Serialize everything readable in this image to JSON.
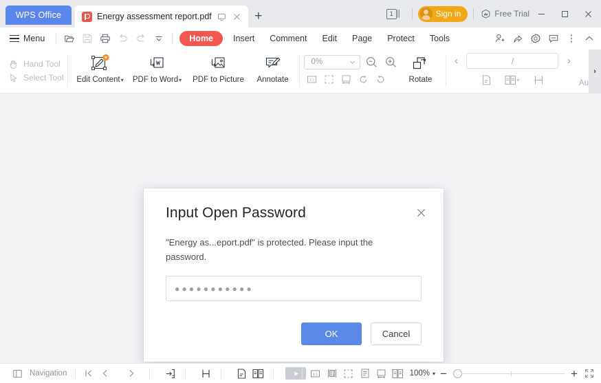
{
  "titlebar": {
    "app_button": "WPS Office",
    "tab": {
      "filename": "Energy assessment report.pdf",
      "icon": "pdf-file-icon",
      "split_icon": "monitor-split-icon",
      "close_icon": "close-icon"
    },
    "new_tab_label": "+",
    "doc_count": "1",
    "sign_in_label": "Sign in",
    "free_trial_label": "Free Trial",
    "window_minimize": "—",
    "window_maximize": "□",
    "window_close": "✕"
  },
  "menubar": {
    "menu_label": "Menu",
    "quick_access": [
      "open-folder-icon",
      "save-icon",
      "print-icon",
      "undo-icon",
      "redo-icon",
      "customize-dropdown-icon"
    ],
    "tabs": [
      {
        "label": "Home",
        "active": true
      },
      {
        "label": "Insert",
        "active": false
      },
      {
        "label": "Comment",
        "active": false
      },
      {
        "label": "Edit",
        "active": false
      },
      {
        "label": "Page",
        "active": false
      },
      {
        "label": "Protect",
        "active": false
      },
      {
        "label": "Tools",
        "active": false
      }
    ],
    "right_icons": [
      "add-user-icon",
      "share-icon",
      "settings-gear-icon",
      "feedback-comment-icon",
      "more-options-icon",
      "collapse-ribbon-icon"
    ]
  },
  "ribbon": {
    "hand_tool": "Hand Tool",
    "select_tool": "Select Tool",
    "buttons": [
      {
        "label": "Edit Content",
        "has_caret": true,
        "badge": "vip-badge"
      },
      {
        "label": "PDF to Word",
        "has_caret": true,
        "badge": ""
      },
      {
        "label": "PDF to Picture",
        "has_caret": false,
        "badge": ""
      },
      {
        "label": "Annotate",
        "has_caret": false,
        "badge": ""
      },
      {
        "label": "Rotate",
        "has_caret": false,
        "badge": ""
      }
    ],
    "zoom_value": "0%",
    "zoom_out_icon": "zoom-out-icon",
    "zoom_in_icon": "zoom-in-icon",
    "small_tools": [
      "actual-size-icon",
      "fit-page-icon",
      "fit-width-icon",
      "rotate-left-icon",
      "rotate-right-icon"
    ],
    "page_input_value": "/",
    "prev_page_icon": "chevron-left-icon",
    "next_page_icon": "chevron-right-icon",
    "view_tools": [
      "single-page-icon",
      "two-page-icon",
      "page-break-icon"
    ],
    "auto_label": "Au",
    "panel_handle": "›"
  },
  "dialog": {
    "title": "Input Open Password",
    "close_icon": "close-icon",
    "message": "\"Energy as...eport.pdf\" is protected. Please input the password.",
    "password_value": "●●●●●●●●●●●",
    "password_placeholder": "",
    "ok_label": "OK",
    "cancel_label": "Cancel"
  },
  "statusbar": {
    "navigation_label": "Navigation",
    "nav_icons": [
      "first-page-icon",
      "prev-page-icon",
      "next-page-icon"
    ],
    "tool_icons": [
      "import-icon",
      "page-break-icon",
      "single-page-icon",
      "two-page-icon"
    ],
    "play_icon": "slideshow-play-icon",
    "view_icons": [
      "actual-size-icon",
      "fit-height-icon",
      "fit-page-icon",
      "reading-mode-icon",
      "fit-width-icon",
      "two-page-view-icon"
    ],
    "zoom_percent": "100%",
    "zoom_minus": "−",
    "zoom_plus": "+",
    "fullscreen_icon": "fullscreen-icon"
  },
  "colors": {
    "accent_blue": "#5b89e8",
    "tab_active_red": "#f2584f",
    "signin_orange": "#f0a818",
    "wps_blue": "#5b86ec",
    "pdf_red": "#e8564a",
    "doc_bg": "#f1f3f5"
  }
}
